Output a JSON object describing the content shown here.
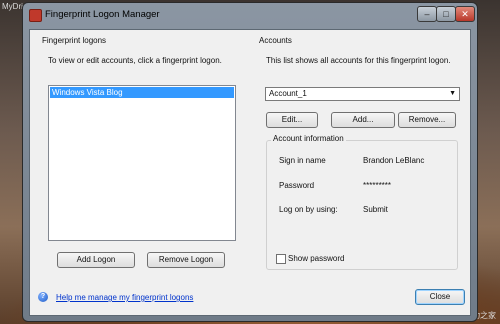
{
  "watermarks": {
    "top": "MyDrivers.com 驱动之家",
    "bottom": "MyDrivers.com 驱动之家"
  },
  "window": {
    "title": "Fingerprint Logon Manager",
    "controls": {
      "minimize": "–",
      "maximize": "□",
      "close": "✕"
    }
  },
  "fingerprint_logons": {
    "title": "Fingerprint logons",
    "description": "To view or edit accounts, click a fingerprint logon.",
    "items": [
      "Windows Vista Blog"
    ],
    "add_label": "Add Logon",
    "remove_label": "Remove Logon"
  },
  "accounts": {
    "title": "Accounts",
    "description": "This list shows all accounts for this fingerprint logon.",
    "selected_account": "Account_1",
    "edit_label": "Edit...",
    "add_label": "Add...",
    "remove_label": "Remove...",
    "info": {
      "title": "Account information",
      "sign_in_label": "Sign in name",
      "sign_in_value": "Brandon LeBlanc",
      "password_label": "Password",
      "password_value": "*********",
      "logon_label": "Log on by using:",
      "logon_value": "Submit",
      "show_password_label": "Show password"
    }
  },
  "footer": {
    "help_icon": "?",
    "help_link": "Help me manage my fingerprint logons",
    "close_label": "Close"
  },
  "colors": {
    "selection": "#3399ff",
    "link": "#0033cc"
  },
  "icons": {
    "app": "fingerprint-app-icon",
    "help": "help-icon",
    "dropdown": "chevron-down-icon",
    "checkbox": "checkbox-icon"
  }
}
